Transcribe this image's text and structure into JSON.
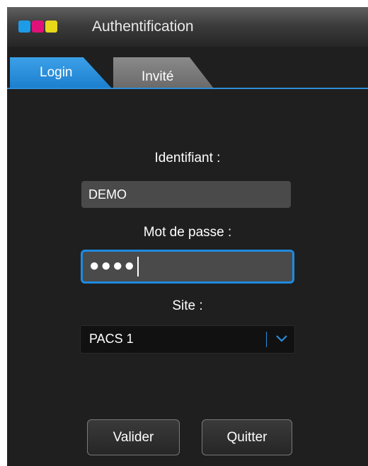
{
  "window": {
    "title": "Authentification",
    "brand_colors": [
      "#1e9be6",
      "#e0127a",
      "#e8d81a"
    ]
  },
  "tabs": [
    {
      "label": "Login",
      "active": true
    },
    {
      "label": "Invité",
      "active": false
    }
  ],
  "form": {
    "username_label": "Identifiant :",
    "username_value": "DEMO",
    "password_label": "Mot de passe :",
    "password_masked": "●●●●",
    "site_label": "Site :",
    "site_value": "PACS 1"
  },
  "buttons": {
    "validate": "Valider",
    "quit": "Quitter"
  },
  "colors": {
    "accent": "#1f8ae0",
    "background": "#1f1f1f"
  }
}
